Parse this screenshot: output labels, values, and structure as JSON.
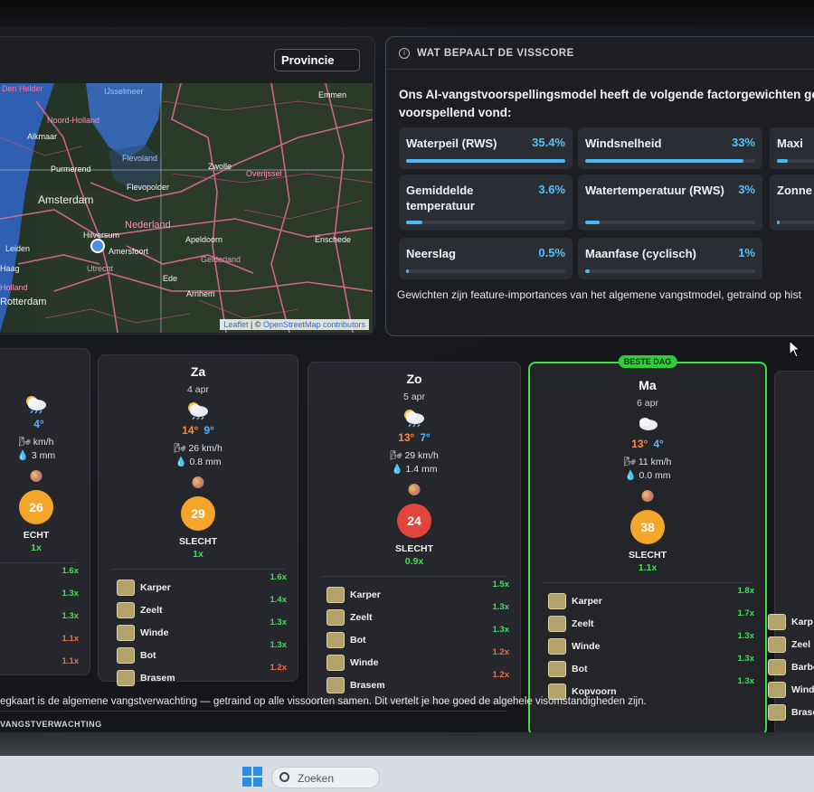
{
  "map": {
    "province_select": "Provincie",
    "labels": [
      "Den Helder",
      "IJsselmeer",
      "Noord-Holland",
      "Alkmaar",
      "Flevoland",
      "Purmerend",
      "Flevopolder",
      "Zwolle",
      "Overijssel",
      "Emmen",
      "Amsterdam",
      "Nederland",
      "Hilversum",
      "Amersfoort",
      "Apeldoorn",
      "Leiden",
      "Utrecht",
      "Gelderland",
      "Enschede",
      "Haag",
      "Holland",
      "Ede",
      "Arnhem",
      "Rotterdam"
    ],
    "attribution_leaflet": "Leaflet",
    "attribution_sep": " | © ",
    "attribution_osm": "OpenStreetMap contributors"
  },
  "factors": {
    "header": "WAT BEPAALT DE VISSCORE",
    "intro_line1": "Ons AI-vangstvoorspellingsmodel heeft de volgende factorgewichten gele",
    "intro_line2": "voorspellend vond:",
    "items": [
      {
        "name": "Waterpeil (RWS)",
        "pct": "35.4%",
        "value": 35.4
      },
      {
        "name": "Windsnelheid",
        "pct": "33%",
        "value": 33
      },
      {
        "name": "Maxi",
        "pct": "",
        "value": 8
      },
      {
        "name": "Gemiddelde temperatuur",
        "pct": "3.6%",
        "value": 3.6
      },
      {
        "name": "Watertemperatuur (RWS)",
        "pct": "3%",
        "value": 3
      },
      {
        "name": "Zonne",
        "pct": "",
        "value": 2
      },
      {
        "name": "Neerslag",
        "pct": "0.5%",
        "value": 0.5
      },
      {
        "name": "Maanfase (cyclisch)",
        "pct": "1%",
        "value": 1
      }
    ],
    "note": "Gewichten zijn feature-importances van het algemene vangstmodel, getraind op hist"
  },
  "days": [
    {
      "name": "",
      "date": "",
      "tmax": "",
      "tmin": "4°",
      "wind": "km/h",
      "rain": "3 mm",
      "score": "26",
      "label": "ECHT",
      "mult": "1x",
      "fish": [
        {
          "name": "",
          "mult": "1.6x",
          "color": "green"
        },
        {
          "name": "",
          "mult": "1.3x",
          "color": "green"
        },
        {
          "name": "",
          "mult": "1.3x",
          "color": "green"
        },
        {
          "name": "",
          "mult": "1.1x",
          "color": "red"
        },
        {
          "name": "",
          "mult": "1.1x",
          "color": "red"
        }
      ]
    },
    {
      "name": "Za",
      "date": "4 apr",
      "tmax": "14°",
      "tmin": "9°",
      "wind": "26 km/h",
      "rain": "0.8 mm",
      "score": "29",
      "label": "SLECHT",
      "mult": "1x",
      "fish": [
        {
          "name": "Karper",
          "mult": "1.6x",
          "color": "green"
        },
        {
          "name": "Zeelt",
          "mult": "1.4x",
          "color": "green"
        },
        {
          "name": "Winde",
          "mult": "1.3x",
          "color": "green"
        },
        {
          "name": "Bot",
          "mult": "1.3x",
          "color": "green"
        },
        {
          "name": "Brasem",
          "mult": "1.2x",
          "color": "red"
        }
      ]
    },
    {
      "name": "Zo",
      "date": "5 apr",
      "tmax": "13°",
      "tmin": "7°",
      "wind": "29 km/h",
      "rain": "1.4 mm",
      "score": "24",
      "label": "SLECHT",
      "mult": "0.9x",
      "fish": [
        {
          "name": "Karper",
          "mult": "1.5x",
          "color": "green"
        },
        {
          "name": "Zeelt",
          "mult": "1.3x",
          "color": "green"
        },
        {
          "name": "Bot",
          "mult": "1.3x",
          "color": "green"
        },
        {
          "name": "Winde",
          "mult": "1.2x",
          "color": "red"
        },
        {
          "name": "Brasem",
          "mult": "1.2x",
          "color": "red"
        }
      ]
    },
    {
      "name": "Ma",
      "date": "6 apr",
      "tmax": "13°",
      "tmin": "4°",
      "wind": "11 km/h",
      "rain": "0.0 mm",
      "score": "38",
      "label": "SLECHT",
      "mult": "1.1x",
      "badge": "BESTE DAG",
      "fish": [
        {
          "name": "Karper",
          "mult": "1.8x",
          "color": "green"
        },
        {
          "name": "Zeelt",
          "mult": "1.7x",
          "color": "green"
        },
        {
          "name": "Winde",
          "mult": "1.3x",
          "color": "green"
        },
        {
          "name": "Bot",
          "mult": "1.3x",
          "color": "green"
        },
        {
          "name": "Kopvoorn",
          "mult": "1.3x",
          "color": "green"
        }
      ]
    },
    {
      "name": "",
      "date": "",
      "fish": [
        {
          "name": "Karp",
          "mult": "",
          "color": "green"
        },
        {
          "name": "Zeel",
          "mult": "",
          "color": "green"
        },
        {
          "name": "Barbe",
          "mult": "",
          "color": "green"
        },
        {
          "name": "Winde",
          "mult": "",
          "color": "green"
        },
        {
          "name": "Braser",
          "mult": "",
          "color": "green"
        }
      ]
    }
  ],
  "footer": {
    "text": "egkaart is de algemene vangstverwachting — getraind op alle vissoorten samen. Dit vertelt je hoe goed de algehele visomstandigheden zijn.",
    "label": "VANGSTVERWACHTING"
  },
  "taskbar": {
    "search_placeholder": "Zoeken"
  },
  "colors": {
    "accent": "#49b8f5",
    "best": "#3ee040",
    "orange_score": "#f4a62a",
    "red_score": "#e2453c"
  }
}
